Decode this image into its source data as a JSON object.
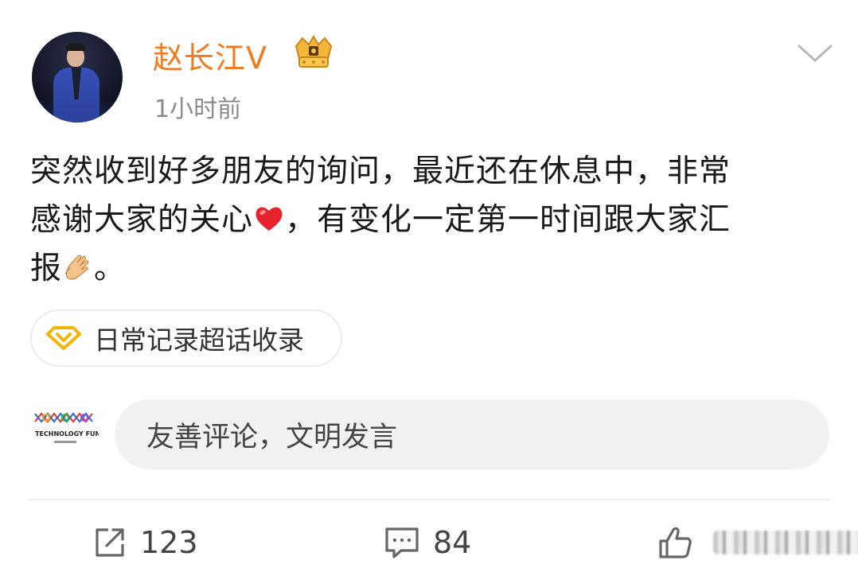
{
  "post": {
    "author": "赵长江V",
    "time": "1小时前",
    "text_line1": "突然收到好多朋友的询问，最近还在休息中，非常",
    "text_line2a": "感谢大家的关心",
    "text_line2b": "，有变化一定第一时间跟大家汇",
    "text_line3a": "报",
    "text_line3b": "。",
    "emojis": [
      "heart-emoji",
      "clap-emoji"
    ]
  },
  "topic": {
    "label": "日常记录超话收录",
    "icon": "diamond-icon"
  },
  "comment_box": {
    "placeholder": "友善评论，文明发言",
    "commenter_logo_text": "TECHNOLOGY FUN"
  },
  "actions": {
    "repost_count": "123",
    "comment_count": "84",
    "like_count": ""
  },
  "colors": {
    "username": "#f07a1c",
    "timestamp": "#8b8b8b",
    "input_bg": "#f2f2f2",
    "topic_icon": "#f5b400"
  }
}
